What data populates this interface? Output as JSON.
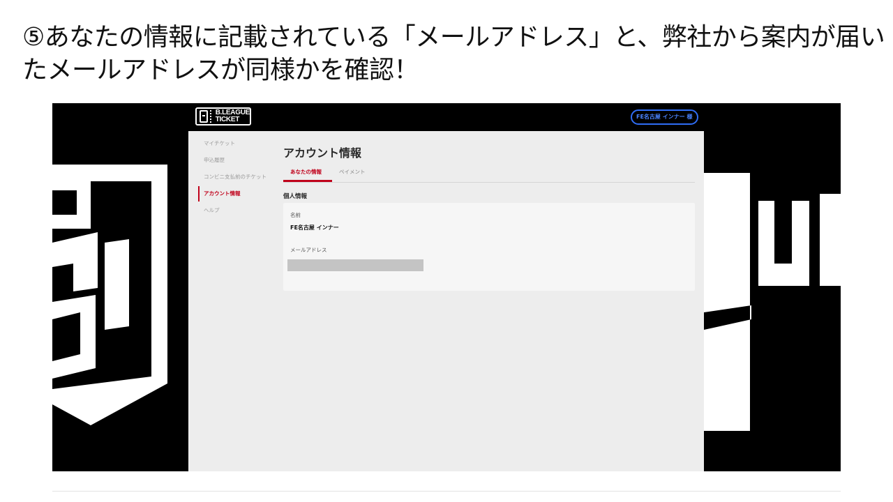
{
  "slide": {
    "title_line1": "⑤あなたの情報に記載されている「メールアドレス」と、弊社から案内が届い",
    "title_line2": "たメールアドレスが同様かを確認！"
  },
  "header": {
    "logo_line1": "B.LEAGUE",
    "logo_line2": "TICKET",
    "user_label": "FE名古屋 インナー 様"
  },
  "sidebar": {
    "items": [
      {
        "label": "マイチケット",
        "active": false
      },
      {
        "label": "申込履歴",
        "active": false
      },
      {
        "label": "コンビニ支払前のチケット",
        "active": false
      },
      {
        "label": "アカウント情報",
        "active": true
      },
      {
        "label": "ヘルプ",
        "active": false
      }
    ]
  },
  "main": {
    "heading": "アカウント情報",
    "tabs": [
      {
        "label": "あなたの情報",
        "active": true
      },
      {
        "label": "ペイメント",
        "active": false
      }
    ],
    "section_title": "個人情報",
    "name_label": "名前",
    "name_value": "FE名古屋 インナー",
    "email_label": "メールアドレス"
  },
  "colors": {
    "accent": "#c0001a",
    "background": "#000000",
    "panel": "#ededed",
    "pill_border": "#2f6df5"
  }
}
